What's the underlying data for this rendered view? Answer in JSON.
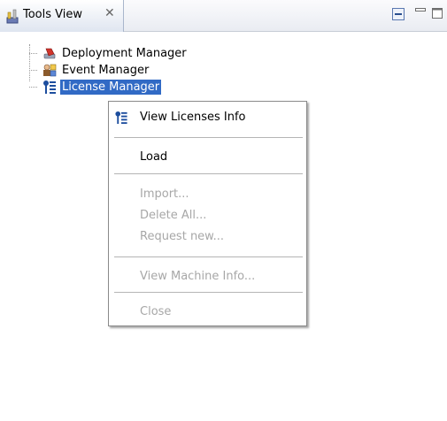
{
  "view": {
    "title": "Tools View",
    "icons": {
      "view": "tools-icon",
      "close": "close-icon",
      "collapse": "collapse-all-icon",
      "minimize": "minimize-icon",
      "maximize": "maximize-icon"
    }
  },
  "tree": {
    "items": [
      {
        "label": "Deployment Manager",
        "icon": "deployment-icon",
        "selected": false
      },
      {
        "label": "Event Manager",
        "icon": "event-icon",
        "selected": false
      },
      {
        "label": "License Manager",
        "icon": "license-icon",
        "selected": true
      }
    ]
  },
  "context_menu": {
    "items": [
      {
        "label": "View Licenses Info",
        "enabled": true,
        "icon": "license-icon"
      },
      {
        "label": "Load",
        "enabled": true
      },
      {
        "label": "Import...",
        "enabled": false
      },
      {
        "label": "Delete All...",
        "enabled": false
      },
      {
        "label": "Request new...",
        "enabled": false
      },
      {
        "label": "View Machine Info...",
        "enabled": false
      },
      {
        "label": "Close",
        "enabled": false
      }
    ]
  },
  "colors": {
    "selection": "#316ac5",
    "disabled_text": "#a7a7a7"
  }
}
